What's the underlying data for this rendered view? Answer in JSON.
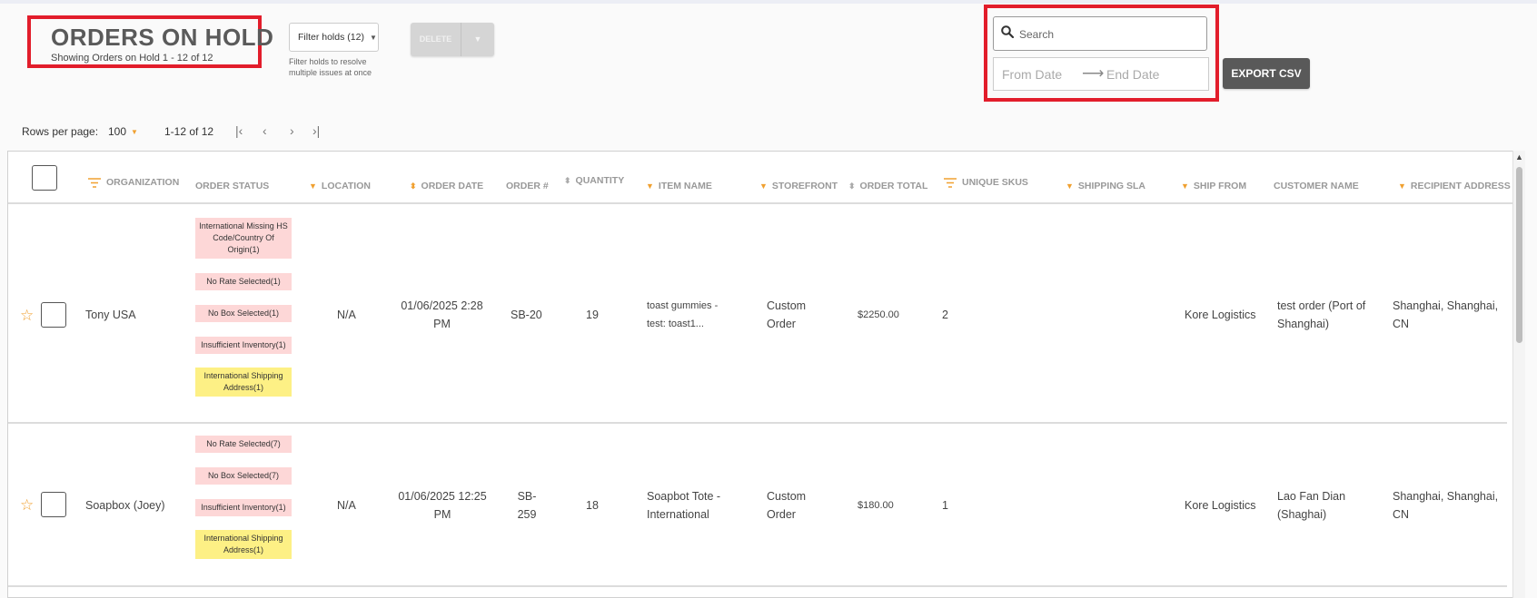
{
  "header": {
    "title": "ORDERS ON HOLD",
    "subtitle": "Showing Orders on Hold 1 - 12 of 12",
    "filter_button": "Filter holds (12)",
    "filter_hint": "Filter holds to resolve multiple issues at once",
    "delete_button": "DELETE",
    "search_placeholder": "Search",
    "from_date": "From Date",
    "end_date": "End Date",
    "export_button": "EXPORT CSV"
  },
  "pagination": {
    "rows_per_page_label": "Rows per page:",
    "rows_per_page_value": "100",
    "range": "1-12 of 12"
  },
  "table": {
    "columns": [
      "ORGANIZATION",
      "ORDER STATUS",
      "LOCATION",
      "ORDER DATE",
      "ORDER #",
      "QUANTITY",
      "ITEM NAME",
      "STOREFRONT",
      "ORDER TOTAL",
      "UNIQUE SKUS",
      "SHIPPING SLA",
      "SHIP FROM",
      "CUSTOMER NAME",
      "RECIPIENT ADDRESS"
    ],
    "rows": [
      {
        "organization": "Tony USA",
        "statuses": [
          {
            "text": "International Missing HS Code/Country Of Origin(1)",
            "color": "pink"
          },
          {
            "text": "No Rate Selected(1)",
            "color": "pink"
          },
          {
            "text": "No Box Selected(1)",
            "color": "pink"
          },
          {
            "text": "Insufficient Inventory(1)",
            "color": "pink"
          },
          {
            "text": "International Shipping Address(1)",
            "color": "yellow"
          }
        ],
        "location": "N/A",
        "order_date": "01/06/2025 2:28 PM",
        "order_no": "SB-20",
        "quantity": "19",
        "item_name": "toast gummies - test: toast1...",
        "storefront": "Custom Order",
        "order_total": "$2250.00",
        "unique_skus": "2",
        "shipping_sla": "",
        "ship_from": "Kore Logistics",
        "customer_name": "test order (Port of Shanghai)",
        "recipient_address": "Shanghai, Shanghai, CN"
      },
      {
        "organization": "Soapbox (Joey)",
        "statuses": [
          {
            "text": "No Rate Selected(7)",
            "color": "pink"
          },
          {
            "text": "No Box Selected(7)",
            "color": "pink"
          },
          {
            "text": "Insufficient Inventory(1)",
            "color": "pink"
          },
          {
            "text": "International Shipping Address(1)",
            "color": "yellow"
          }
        ],
        "location": "N/A",
        "order_date": "01/06/2025 12:25 PM",
        "order_no": "SB-259",
        "quantity": "18",
        "item_name": "Soapbot Tote - International",
        "storefront": "Custom Order",
        "order_total": "$180.00",
        "unique_skus": "1",
        "shipping_sla": "",
        "ship_from": "Kore Logistics",
        "customer_name": "Lao Fan Dian (Shaghai)",
        "recipient_address": "Shanghai, Shanghai, CN"
      }
    ]
  },
  "colors": {
    "accent": "#f0a030",
    "highlight_border": "#e21d2b",
    "status_pink": "#fdd7d7",
    "status_yellow": "#fdf085",
    "export_bg": "#595959"
  },
  "icons": {
    "search": "search-icon",
    "filter": "filter-lines-icon",
    "sort": "sort-arrow-icon",
    "star": "star-outline-icon"
  }
}
